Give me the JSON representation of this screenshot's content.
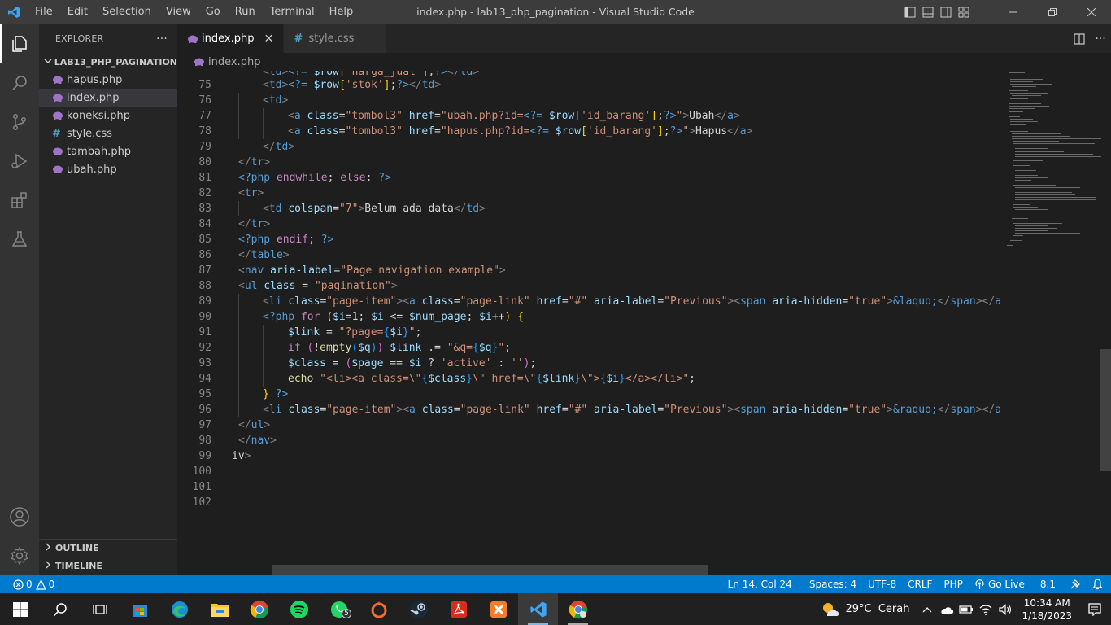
{
  "app": {
    "window_title": "index.php - lab13_php_pagination - Visual Studio Code",
    "menu": [
      "File",
      "Edit",
      "Selection",
      "View",
      "Go",
      "Run",
      "Terminal",
      "Help"
    ]
  },
  "sidebar": {
    "title": "EXPLORER",
    "more": "···",
    "folder": "LAB13_PHP_PAGINATION",
    "files": [
      {
        "name": "hapus.php",
        "type": "php"
      },
      {
        "name": "index.php",
        "type": "php"
      },
      {
        "name": "koneksi.php",
        "type": "php"
      },
      {
        "name": "style.css",
        "type": "css"
      },
      {
        "name": "tambah.php",
        "type": "php"
      },
      {
        "name": "ubah.php",
        "type": "php"
      }
    ],
    "outline": "OUTLINE",
    "timeline": "TIMELINE"
  },
  "tabs": [
    {
      "label": "index.php",
      "close": "✕"
    },
    {
      "label": "style.css"
    }
  ],
  "breadcrumb": "index.php",
  "editor": {
    "line_numbers": [
      "75",
      "76",
      "77",
      "78",
      "79",
      "80",
      "81",
      "82",
      "83",
      "84",
      "85",
      "86",
      "87",
      "88",
      "89",
      "90",
      "91",
      "92",
      "93",
      "94",
      "95",
      "96",
      "97",
      "98",
      "99",
      "100",
      "101",
      "102"
    ]
  },
  "statusbar": {
    "errors": "0",
    "warnings": "0",
    "position": "Ln 14, Col 24",
    "spaces": "Spaces: 4",
    "encoding": "UTF-8",
    "eol": "CRLF",
    "language": "PHP",
    "golive": "Go Live",
    "version": "8.1"
  },
  "taskbar": {
    "whatsapp_badge": "5",
    "weather": "29°C  Cerah",
    "time": "10:34 AM",
    "date": "1/18/2023"
  },
  "colors": {
    "accent": "#007acc",
    "titlebar": "#3c3c3c",
    "sidebar": "#252526",
    "editor": "#1e1e1e"
  }
}
